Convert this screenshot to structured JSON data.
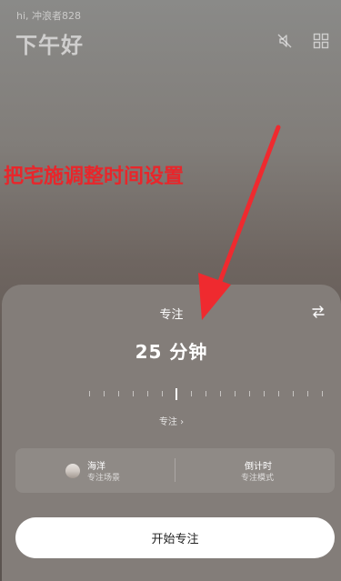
{
  "header": {
    "user_greeting": "hi, 冲浪者828",
    "time_greeting": "下午好",
    "icons": [
      "mute-icon",
      "grid-icon"
    ]
  },
  "annotation": {
    "text": "把宅施调整时间设置",
    "color": "#e8262b"
  },
  "panel": {
    "title": "专注",
    "duration": "25 分钟",
    "mode_link": "专注 ›",
    "scene": {
      "title": "海洋",
      "subtitle": "专注场景"
    },
    "timer_mode": {
      "title": "倒计时",
      "subtitle": "专注模式"
    },
    "start_button": "开始专注"
  }
}
